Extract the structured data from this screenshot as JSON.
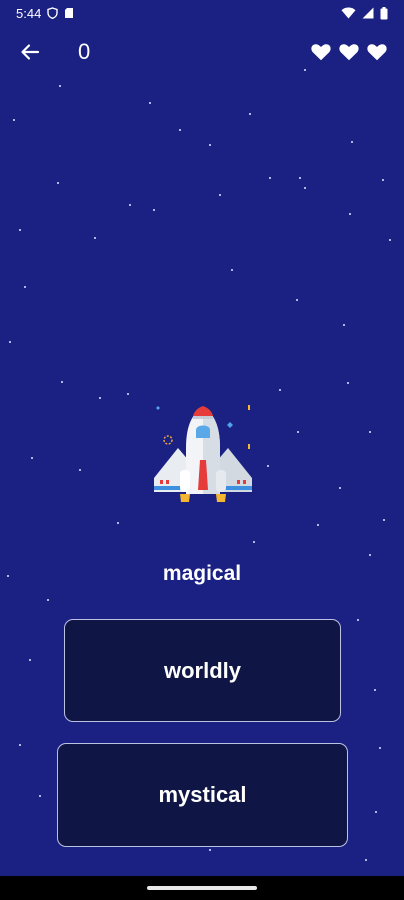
{
  "status_bar": {
    "time": "5:44"
  },
  "header": {
    "score": "0",
    "lives": 3
  },
  "question": {
    "word": "magical"
  },
  "options": [
    {
      "label": "worldly"
    },
    {
      "label": "mystical"
    }
  ],
  "icons": {
    "back": "arrow-left-icon",
    "heart": "heart-icon",
    "illustration": "rocket-icon"
  },
  "colors": {
    "background": "#1a2182",
    "option_background": "#0f1544",
    "option_border": "#dce0ff"
  }
}
